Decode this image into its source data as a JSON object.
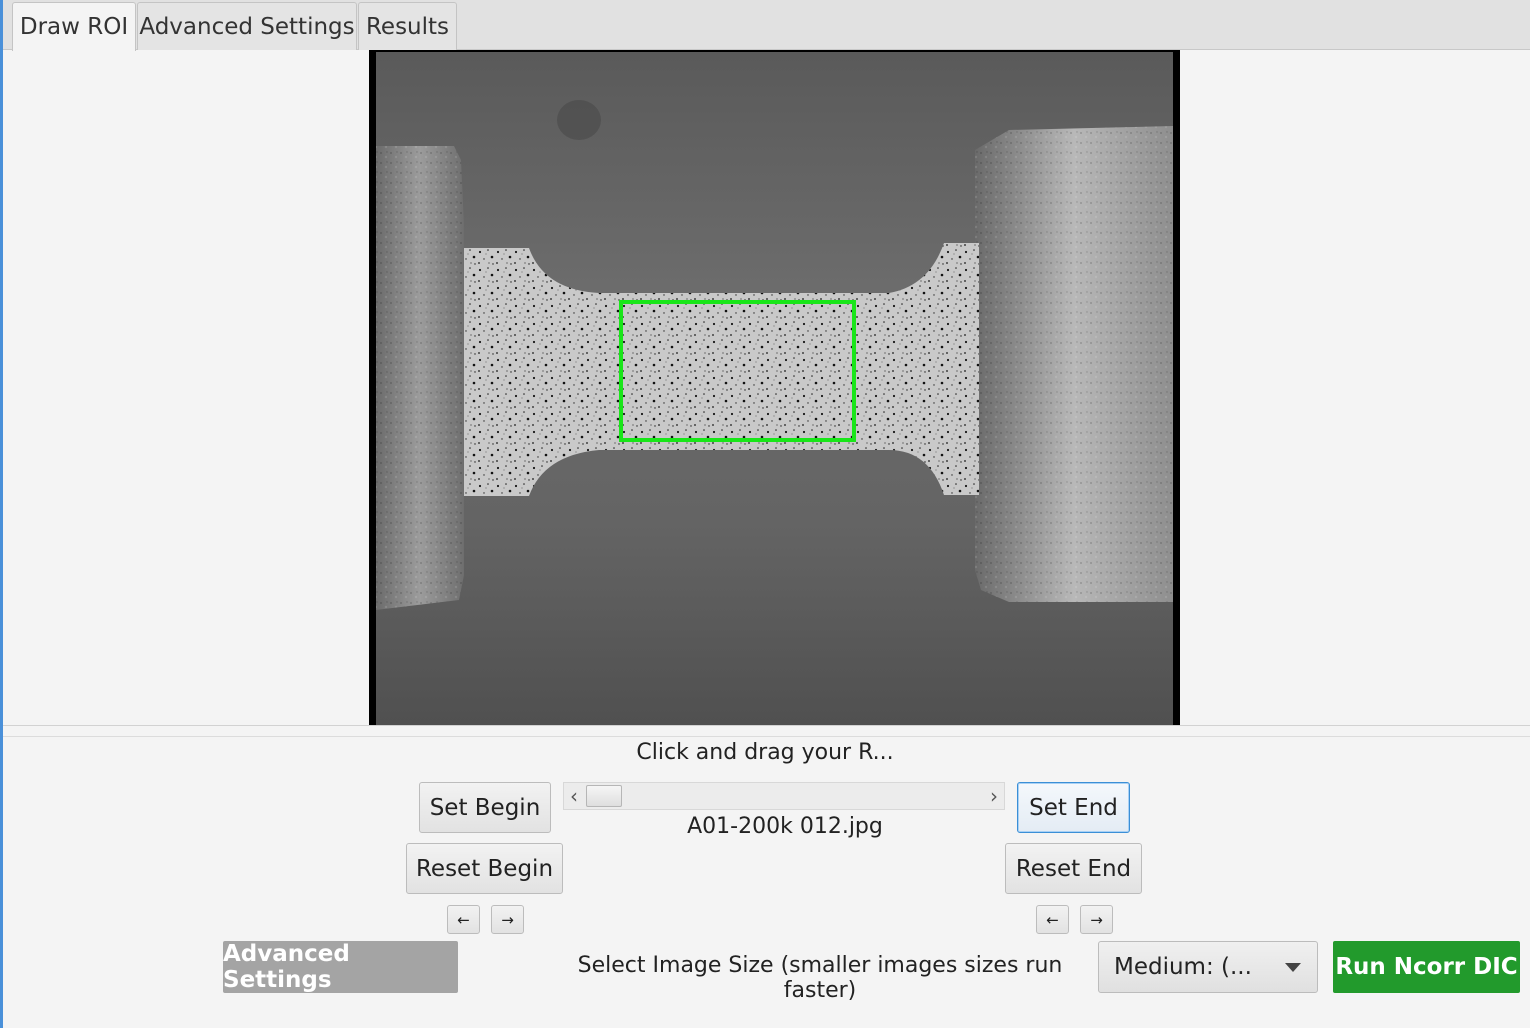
{
  "tabs": [
    {
      "label": "Draw ROI",
      "active": true
    },
    {
      "label": "Advanced Settings",
      "active": false
    },
    {
      "label": "Results",
      "active": false
    }
  ],
  "viewer": {
    "roi_color": "#19e619"
  },
  "instruction": "Click and drag your R...",
  "controls": {
    "set_begin": "Set Begin",
    "reset_begin": "Reset Begin",
    "set_end": "Set End",
    "reset_end": "Reset End",
    "arrow_left": "←",
    "arrow_right": "→",
    "slider_left": "‹",
    "slider_right": "›",
    "filename": "A01-200k 012.jpg"
  },
  "bottom": {
    "advanced_settings": "Advanced Settings",
    "image_size_label": "Select Image Size (smaller images sizes run faster)",
    "image_size_value": "Medium: (...",
    "run_button": "Run Ncorr DIC",
    "run_color": "#229a2c"
  }
}
